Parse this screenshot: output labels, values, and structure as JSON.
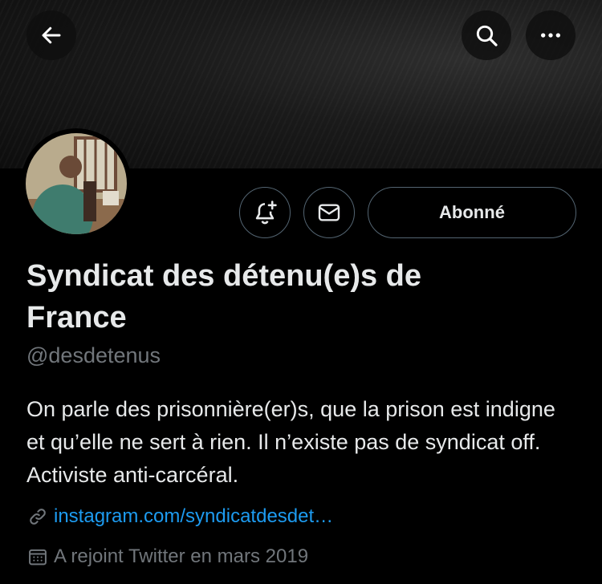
{
  "header": {
    "back_icon": "arrow-left-icon",
    "search_icon": "search-icon",
    "more_icon": "more-horizontal-icon"
  },
  "actions": {
    "notify_icon": "bell-plus-icon",
    "message_icon": "envelope-icon",
    "follow_label": "Abonné"
  },
  "profile": {
    "name": "Syndicat des détenu(e)s de France",
    "handle": "@desdetenus",
    "bio": "On parle des prisonnière(er)s, que la prison est indigne et qu’elle ne sert à rien. Il n’existe pas de syndicat off. Activiste anti-carcéral.",
    "link": "instagram.com/syndicatdesdet…",
    "joined": "A rejoint Twitter en mars 2019"
  },
  "colors": {
    "background": "#000000",
    "text": "#e7e9ea",
    "muted": "#71767b",
    "link": "#1d9bf0",
    "border": "#536471"
  }
}
